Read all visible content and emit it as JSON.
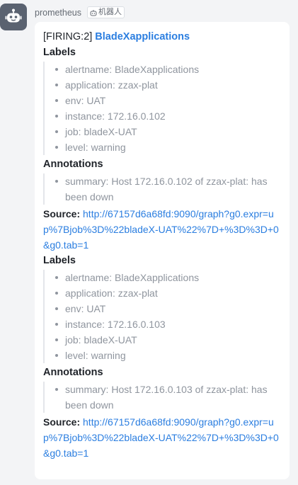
{
  "sender": {
    "name": "prometheus",
    "tag": "机器人",
    "avatar_icon": "robot-icon"
  },
  "message": {
    "status": "[FIRING:2]",
    "alert_title": "BladeXapplications",
    "alerts": [
      {
        "labels_heading": "Labels",
        "labels": [
          "alertname: BladeXapplications",
          "application: zzax-plat",
          "env: UAT",
          "instance: 172.16.0.102",
          "job: bladeX-UAT",
          "level: warning"
        ],
        "annotations_heading": "Annotations",
        "annotations": [
          "summary: Host 172.16.0.102 of zzax-plat: has been down"
        ],
        "source_label": "Source:",
        "source_url": "http://67157d6a68fd:9090/graph?g0.expr=up%7Bjob%3D%22bladeX-UAT%22%7D+%3D%3D+0&g0.tab=1"
      },
      {
        "labels_heading": "Labels",
        "labels": [
          "alertname: BladeXapplications",
          "application: zzax-plat",
          "env: UAT",
          "instance: 172.16.0.103",
          "job: bladeX-UAT",
          "level: warning"
        ],
        "annotations_heading": "Annotations",
        "annotations": [
          "summary: Host 172.16.0.103 of zzax-plat: has been down"
        ],
        "source_label": "Source:",
        "source_url": "http://67157d6a68fd:9090/graph?g0.expr=up%7Bjob%3D%22bladeX-UAT%22%7D+%3D%3D+0&g0.tab=1"
      }
    ]
  },
  "colors": {
    "link": "#2b7ee0",
    "muted": "#8f959e",
    "avatar_bg": "#5a6270"
  }
}
